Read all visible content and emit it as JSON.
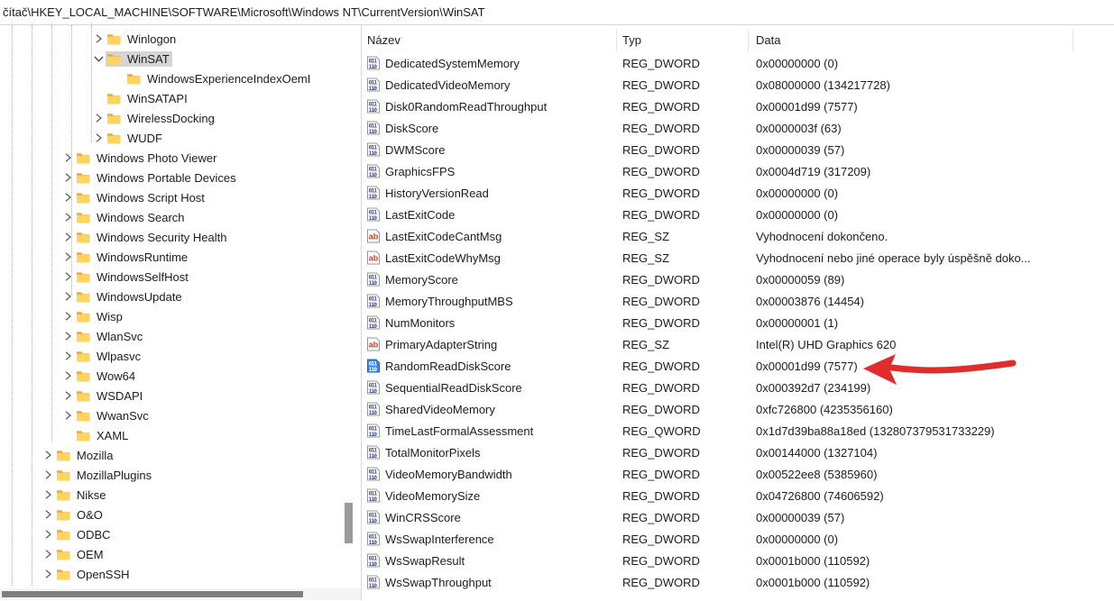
{
  "address_bar": {
    "path": "čítač\\HKEY_LOCAL_MACHINE\\SOFTWARE\\Microsoft\\Windows NT\\CurrentVersion\\WinSAT"
  },
  "tree": {
    "items": [
      {
        "label": "Winlogon",
        "level": 4,
        "expander": "collapsed",
        "selected": false
      },
      {
        "label": "WinSAT",
        "level": 4,
        "expander": "expanded",
        "selected": true
      },
      {
        "label": "WindowsExperienceIndexOemI",
        "level": 5,
        "expander": "none",
        "selected": false
      },
      {
        "label": "WinSATAPI",
        "level": 4,
        "expander": "none",
        "selected": false
      },
      {
        "label": "WirelessDocking",
        "level": 4,
        "expander": "collapsed",
        "selected": false
      },
      {
        "label": "WUDF",
        "level": 4,
        "expander": "collapsed",
        "selected": false
      },
      {
        "label": "Windows Photo Viewer",
        "level": 3,
        "expander": "collapsed",
        "selected": false
      },
      {
        "label": "Windows Portable Devices",
        "level": 3,
        "expander": "collapsed",
        "selected": false
      },
      {
        "label": "Windows Script Host",
        "level": 3,
        "expander": "collapsed",
        "selected": false
      },
      {
        "label": "Windows Search",
        "level": 3,
        "expander": "collapsed",
        "selected": false
      },
      {
        "label": "Windows Security Health",
        "level": 3,
        "expander": "collapsed",
        "selected": false
      },
      {
        "label": "WindowsRuntime",
        "level": 3,
        "expander": "collapsed",
        "selected": false
      },
      {
        "label": "WindowsSelfHost",
        "level": 3,
        "expander": "collapsed",
        "selected": false
      },
      {
        "label": "WindowsUpdate",
        "level": 3,
        "expander": "collapsed",
        "selected": false
      },
      {
        "label": "Wisp",
        "level": 3,
        "expander": "collapsed",
        "selected": false
      },
      {
        "label": "WlanSvc",
        "level": 3,
        "expander": "collapsed",
        "selected": false
      },
      {
        "label": "Wlpasvc",
        "level": 3,
        "expander": "collapsed",
        "selected": false
      },
      {
        "label": "Wow64",
        "level": 3,
        "expander": "collapsed",
        "selected": false
      },
      {
        "label": "WSDAPI",
        "level": 3,
        "expander": "collapsed",
        "selected": false
      },
      {
        "label": "WwanSvc",
        "level": 3,
        "expander": "collapsed",
        "selected": false
      },
      {
        "label": "XAML",
        "level": 3,
        "expander": "none",
        "selected": false
      },
      {
        "label": "Mozilla",
        "level": 2,
        "expander": "collapsed",
        "selected": false
      },
      {
        "label": "MozillaPlugins",
        "level": 2,
        "expander": "collapsed",
        "selected": false
      },
      {
        "label": "Nikse",
        "level": 2,
        "expander": "collapsed",
        "selected": false
      },
      {
        "label": "O&O",
        "level": 2,
        "expander": "collapsed",
        "selected": false
      },
      {
        "label": "ODBC",
        "level": 2,
        "expander": "collapsed",
        "selected": false
      },
      {
        "label": "OEM",
        "level": 2,
        "expander": "collapsed",
        "selected": false
      },
      {
        "label": "OpenSSH",
        "level": 2,
        "expander": "collapsed",
        "selected": false
      }
    ]
  },
  "list": {
    "columns": [
      "Název",
      "Typ",
      "Data"
    ],
    "rows": [
      {
        "name": "DedicatedSystemMemory",
        "type": "REG_DWORD",
        "data": "0x00000000 (0)",
        "icon": "dword"
      },
      {
        "name": "DedicatedVideoMemory",
        "type": "REG_DWORD",
        "data": "0x08000000 (134217728)",
        "icon": "dword"
      },
      {
        "name": "Disk0RandomReadThroughput",
        "type": "REG_DWORD",
        "data": "0x00001d99 (7577)",
        "icon": "dword"
      },
      {
        "name": "DiskScore",
        "type": "REG_DWORD",
        "data": "0x0000003f (63)",
        "icon": "dword"
      },
      {
        "name": "DWMScore",
        "type": "REG_DWORD",
        "data": "0x00000039 (57)",
        "icon": "dword"
      },
      {
        "name": "GraphicsFPS",
        "type": "REG_DWORD",
        "data": "0x0004d719 (317209)",
        "icon": "dword"
      },
      {
        "name": "HistoryVersionRead",
        "type": "REG_DWORD",
        "data": "0x00000000 (0)",
        "icon": "dword"
      },
      {
        "name": "LastExitCode",
        "type": "REG_DWORD",
        "data": "0x00000000 (0)",
        "icon": "dword"
      },
      {
        "name": "LastExitCodeCantMsg",
        "type": "REG_SZ",
        "data": "Vyhodnocení dokončeno.",
        "icon": "sz"
      },
      {
        "name": "LastExitCodeWhyMsg",
        "type": "REG_SZ",
        "data": "Vyhodnocení nebo jiné operace byly úspěšně doko...",
        "icon": "sz"
      },
      {
        "name": "MemoryScore",
        "type": "REG_DWORD",
        "data": "0x00000059 (89)",
        "icon": "dword"
      },
      {
        "name": "MemoryThroughputMBS",
        "type": "REG_DWORD",
        "data": "0x00003876 (14454)",
        "icon": "dword"
      },
      {
        "name": "NumMonitors",
        "type": "REG_DWORD",
        "data": "0x00000001 (1)",
        "icon": "dword"
      },
      {
        "name": "PrimaryAdapterString",
        "type": "REG_SZ",
        "data": "Intel(R) UHD Graphics 620",
        "icon": "sz"
      },
      {
        "name": "RandomReadDiskScore",
        "type": "REG_DWORD",
        "data": "0x00001d99 (7577)",
        "icon": "dword-selected"
      },
      {
        "name": "SequentialReadDiskScore",
        "type": "REG_DWORD",
        "data": "0x000392d7 (234199)",
        "icon": "dword"
      },
      {
        "name": "SharedVideoMemory",
        "type": "REG_DWORD",
        "data": "0xfc726800 (4235356160)",
        "icon": "dword"
      },
      {
        "name": "TimeLastFormalAssessment",
        "type": "REG_QWORD",
        "data": "0x1d7d39ba88a18ed (132807379531733229)",
        "icon": "dword"
      },
      {
        "name": "TotalMonitorPixels",
        "type": "REG_DWORD",
        "data": "0x00144000 (1327104)",
        "icon": "dword"
      },
      {
        "name": "VideoMemoryBandwidth",
        "type": "REG_DWORD",
        "data": "0x00522ee8 (5385960)",
        "icon": "dword"
      },
      {
        "name": "VideoMemorySize",
        "type": "REG_DWORD",
        "data": "0x04726800 (74606592)",
        "icon": "dword"
      },
      {
        "name": "WinCRSScore",
        "type": "REG_DWORD",
        "data": "0x00000039 (57)",
        "icon": "dword"
      },
      {
        "name": "WsSwapInterference",
        "type": "REG_DWORD",
        "data": "0x00000000 (0)",
        "icon": "dword"
      },
      {
        "name": "WsSwapResult",
        "type": "REG_DWORD",
        "data": "0x0001b000 (110592)",
        "icon": "dword"
      },
      {
        "name": "WsSwapThroughput",
        "type": "REG_DWORD",
        "data": "0x0001b000 (110592)",
        "icon": "dword"
      }
    ]
  },
  "annotation": {
    "color": "#e22c2c",
    "points_at": "0x00001d99 (7577)"
  },
  "colors": {
    "selected_bg": "#d5d5d5",
    "dword_blue": "#2f49c6",
    "sz_red": "#c63f22",
    "folder_yellow": "#ffd45f",
    "folder_tab": "#e9a93f",
    "scrollbar_thumb": "#8a8a8a"
  }
}
